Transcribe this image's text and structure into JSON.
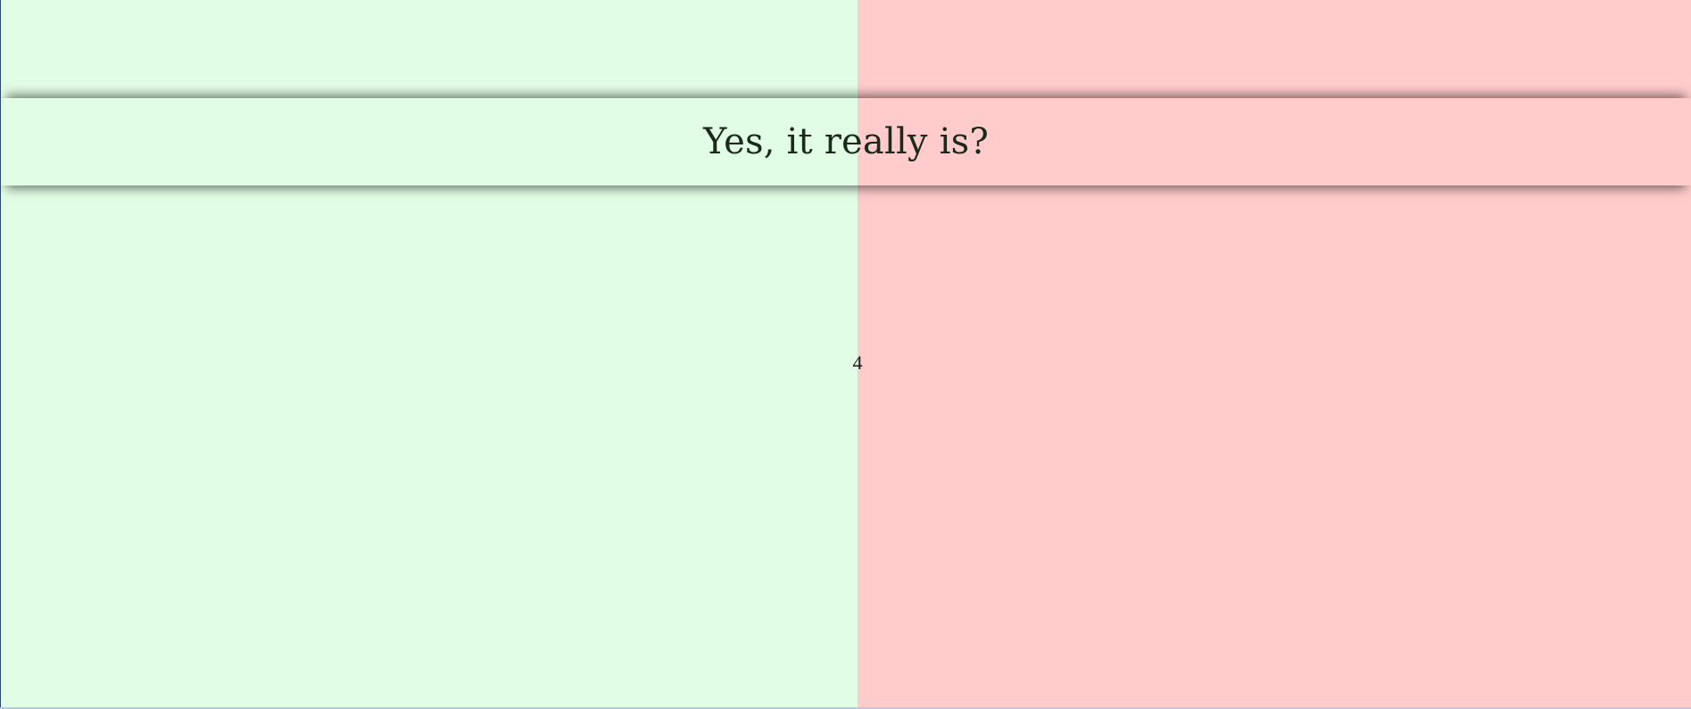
{
  "banner": {
    "text": "Yes, it really is?"
  },
  "counter": {
    "value": "4"
  },
  "colors": {
    "left_pane": "#e2fde6",
    "right_pane": "#ffcccb",
    "text": "#1b2a1c"
  }
}
